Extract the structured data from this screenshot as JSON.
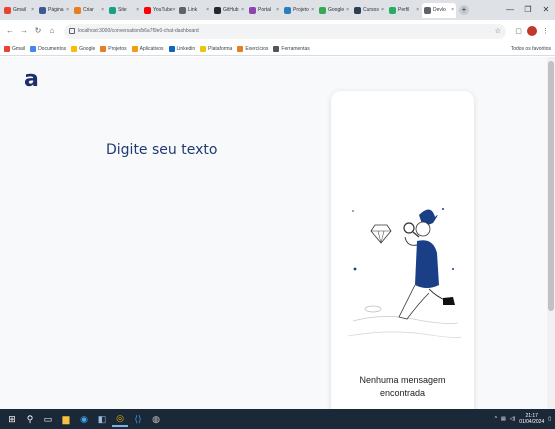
{
  "browser": {
    "tabs": [
      {
        "label": "Gmail",
        "color": "#ea4335",
        "active": false
      },
      {
        "label": "Página",
        "color": "#3b5998",
        "active": false
      },
      {
        "label": "Criar",
        "color": "#e67e22",
        "active": false
      },
      {
        "label": "Site",
        "color": "#16a085",
        "active": false
      },
      {
        "label": "YouTube",
        "color": "#ff0000",
        "active": false
      },
      {
        "label": "Link",
        "color": "#5f6368",
        "active": false
      },
      {
        "label": "GitHub",
        "color": "#24292e",
        "active": false
      },
      {
        "label": "Portal",
        "color": "#8e44ad",
        "active": false
      },
      {
        "label": "Projeto",
        "color": "#2980b9",
        "active": false
      },
      {
        "label": "Google",
        "color": "#34a853",
        "active": false
      },
      {
        "label": "Cursos",
        "color": "#2c3e50",
        "active": false
      },
      {
        "label": "Perfil",
        "color": "#27ae60",
        "active": false
      },
      {
        "label": "Devlo",
        "color": "#5f6368",
        "active": true
      }
    ],
    "new_tab_label": "+",
    "url": "localhost:3000/conversation/b6a7f9e0-chat-dashboard",
    "bookmarks": [
      {
        "label": "Gmail",
        "color": "#ea4335"
      },
      {
        "label": "Documentos",
        "color": "#4285f4"
      },
      {
        "label": "Google",
        "color": "#fbbc05"
      },
      {
        "label": "Projetos",
        "color": "#e67e22"
      },
      {
        "label": "Aplicativos",
        "color": "#f39c12"
      },
      {
        "label": "Linkedin",
        "color": "#0a66c2"
      },
      {
        "label": "Plataforma",
        "color": "#f1c40f"
      },
      {
        "label": "Exercícios",
        "color": "#e67e22"
      },
      {
        "label": "Ferramentas",
        "color": "#555555"
      }
    ],
    "bookmarks_right": "Todos os favoritos"
  },
  "page": {
    "logo": "a",
    "prompt": "Digite seu texto",
    "empty_state": {
      "message_line1": "Nenhuma mensagem",
      "message_line2": "encontrada"
    }
  },
  "taskbar": {
    "time": "21:17",
    "date": "01/04/2024"
  },
  "colors": {
    "brand": "#1a2f6b",
    "accent": "#1f3a73",
    "page_bg": "#f8f9fb",
    "taskbar_bg": "#1b2838"
  }
}
